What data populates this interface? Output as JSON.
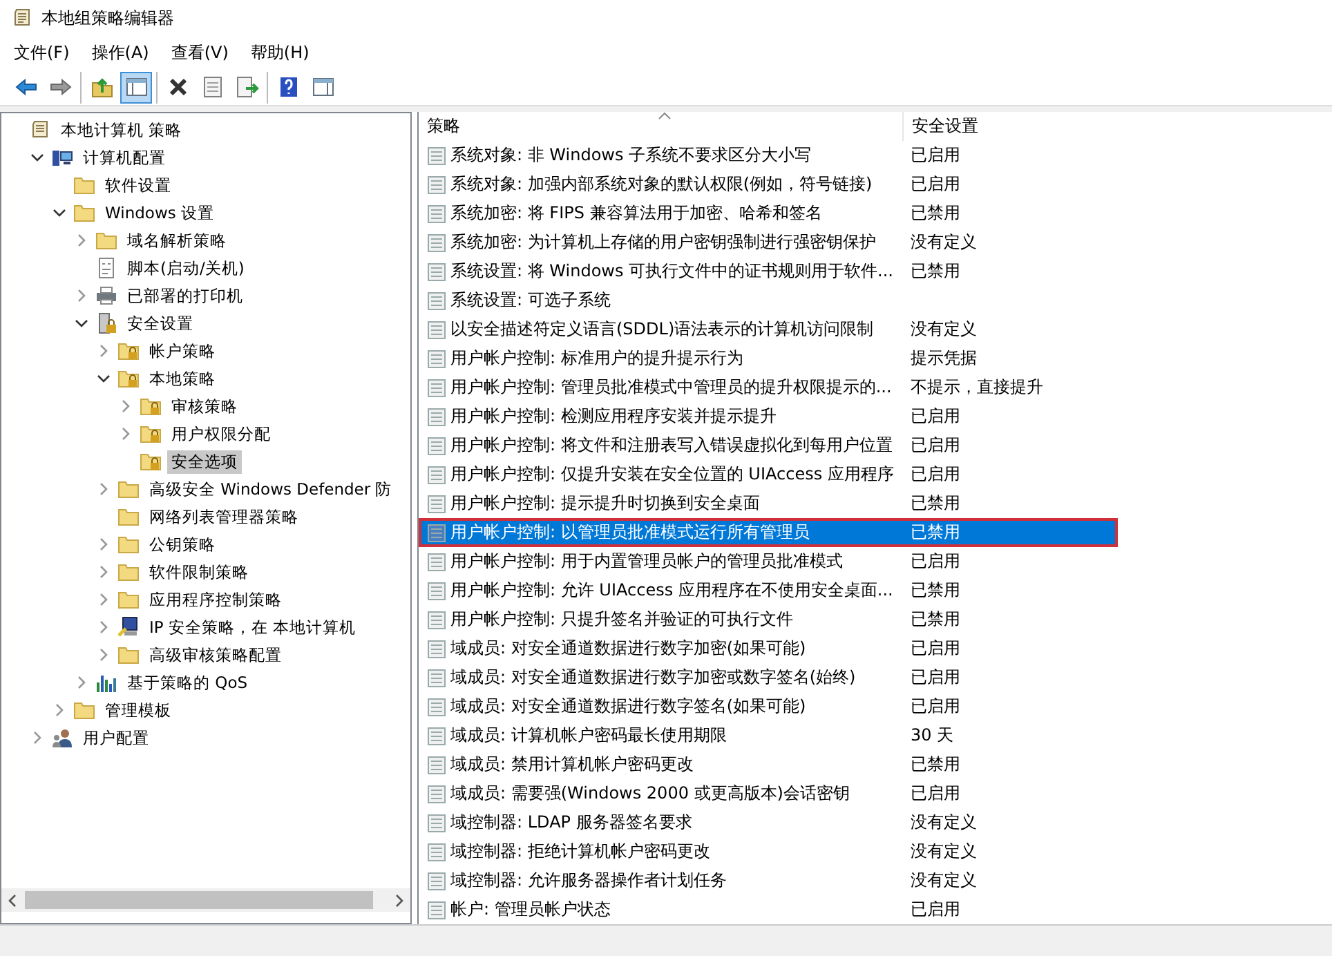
{
  "window": {
    "title": "本地组策略编辑器"
  },
  "menu": [
    "文件(F)",
    "操作(A)",
    "查看(V)",
    "帮助(H)"
  ],
  "toolbar": [
    [
      {
        "kind": "back",
        "pressed": false
      },
      {
        "kind": "forward",
        "pressed": false
      }
    ],
    [
      {
        "kind": "up",
        "pressed": false
      },
      {
        "kind": "tree",
        "pressed": true
      }
    ],
    [
      {
        "kind": "delete",
        "pressed": false
      },
      {
        "kind": "properties",
        "pressed": false
      },
      {
        "kind": "export",
        "pressed": false
      }
    ],
    [
      {
        "kind": "help",
        "pressed": false
      },
      {
        "kind": "pane",
        "pressed": false
      }
    ]
  ],
  "tree": [
    {
      "label": "本地计算机 策略",
      "kind": "doc",
      "selected": false,
      "children": [
        {
          "label": "计算机配置",
          "kind": "computer",
          "expanded": true,
          "selected": false,
          "children": [
            {
              "label": "软件设置",
              "kind": "folder",
              "selected": false
            },
            {
              "label": "Windows 设置",
              "kind": "folder",
              "expanded": true,
              "selected": false,
              "children": [
                {
                  "label": "域名解析策略",
                  "kind": "folder",
                  "expanded": false,
                  "selected": false
                },
                {
                  "label": "脚本(启动/关机)",
                  "kind": "script",
                  "selected": false
                },
                {
                  "label": "已部署的打印机",
                  "kind": "printer",
                  "expanded": false,
                  "selected": false
                },
                {
                  "label": "安全设置",
                  "kind": "secure",
                  "expanded": true,
                  "selected": false,
                  "children": [
                    {
                      "label": "帐户策略",
                      "kind": "lockfolder",
                      "expanded": false,
                      "selected": false
                    },
                    {
                      "label": "本地策略",
                      "kind": "lockfolder",
                      "expanded": true,
                      "selected": false,
                      "children": [
                        {
                          "label": "审核策略",
                          "kind": "lockfolder",
                          "expanded": false,
                          "selected": false
                        },
                        {
                          "label": "用户权限分配",
                          "kind": "lockfolder",
                          "expanded": false,
                          "selected": false
                        },
                        {
                          "label": "安全选项",
                          "kind": "lockfolder",
                          "selected": true
                        }
                      ]
                    },
                    {
                      "label": "高级安全 Windows Defender 防",
                      "kind": "folder",
                      "expanded": false,
                      "selected": false
                    },
                    {
                      "label": "网络列表管理器策略",
                      "kind": "folder",
                      "selected": false
                    },
                    {
                      "label": "公钥策略",
                      "kind": "folder",
                      "expanded": false,
                      "selected": false
                    },
                    {
                      "label": "软件限制策略",
                      "kind": "folder",
                      "expanded": false,
                      "selected": false
                    },
                    {
                      "label": "应用程序控制策略",
                      "kind": "folder",
                      "expanded": false,
                      "selected": false
                    },
                    {
                      "label": "IP 安全策略，在 本地计算机",
                      "kind": "ip",
                      "expanded": false,
                      "selected": false
                    },
                    {
                      "label": "高级审核策略配置",
                      "kind": "folder",
                      "expanded": false,
                      "selected": false
                    }
                  ]
                },
                {
                  "label": "基于策略的 QoS",
                  "kind": "qos",
                  "expanded": false,
                  "selected": false
                }
              ]
            },
            {
              "label": "管理模板",
              "kind": "folder",
              "expanded": false,
              "selected": false
            }
          ]
        },
        {
          "label": "用户配置",
          "kind": "user",
          "expanded": false,
          "selected": false
        }
      ]
    }
  ],
  "table": {
    "columns": [
      "策略",
      "安全设置"
    ],
    "rows": [
      {
        "policy": "系统对象: 非 Windows 子系统不要求区分大小写",
        "setting": "已启用",
        "selected": false
      },
      {
        "policy": "系统对象: 加强内部系统对象的默认权限(例如，符号链接)",
        "setting": "已启用",
        "selected": false
      },
      {
        "policy": "系统加密: 将 FIPS 兼容算法用于加密、哈希和签名",
        "setting": "已禁用",
        "selected": false
      },
      {
        "policy": "系统加密: 为计算机上存储的用户密钥强制进行强密钥保护",
        "setting": "没有定义",
        "selected": false
      },
      {
        "policy": "系统设置: 将 Windows 可执行文件中的证书规则用于软件...",
        "setting": "已禁用",
        "selected": false
      },
      {
        "policy": "系统设置: 可选子系统",
        "selected": false
      },
      {
        "policy": "以安全描述符定义语言(SDDL)语法表示的计算机访问限制",
        "setting": "没有定义",
        "selected": false
      },
      {
        "policy": "用户帐户控制: 标准用户的提升提示行为",
        "setting": "提示凭据",
        "selected": false
      },
      {
        "policy": "用户帐户控制: 管理员批准模式中管理员的提升权限提示的...",
        "setting": "不提示，直接提升",
        "selected": false
      },
      {
        "policy": "用户帐户控制: 检测应用程序安装并提示提升",
        "setting": "已启用",
        "selected": false
      },
      {
        "policy": "用户帐户控制: 将文件和注册表写入错误虚拟化到每用户位置",
        "setting": "已启用",
        "selected": false
      },
      {
        "policy": "用户帐户控制: 仅提升安装在安全位置的 UIAccess 应用程序",
        "setting": "已启用",
        "selected": false
      },
      {
        "policy": "用户帐户控制: 提示提升时切换到安全桌面",
        "setting": "已禁用",
        "selected": false
      },
      {
        "policy": "用户帐户控制: 以管理员批准模式运行所有管理员",
        "setting": "已禁用",
        "selected": true
      },
      {
        "policy": "用户帐户控制: 用于内置管理员帐户的管理员批准模式",
        "setting": "已启用",
        "selected": false
      },
      {
        "policy": "用户帐户控制: 允许 UIAccess 应用程序在不使用安全桌面...",
        "setting": "已禁用",
        "selected": false
      },
      {
        "policy": "用户帐户控制: 只提升签名并验证的可执行文件",
        "setting": "已禁用",
        "selected": false
      },
      {
        "policy": "域成员: 对安全通道数据进行数字加密(如果可能)",
        "setting": "已启用",
        "selected": false
      },
      {
        "policy": "域成员: 对安全通道数据进行数字加密或数字签名(始终)",
        "setting": "已启用",
        "selected": false
      },
      {
        "policy": "域成员: 对安全通道数据进行数字签名(如果可能)",
        "setting": "已启用",
        "selected": false
      },
      {
        "policy": "域成员: 计算机帐户密码最长使用期限",
        "setting": "30 天",
        "selected": false
      },
      {
        "policy": "域成员: 禁用计算机帐户密码更改",
        "setting": "已禁用",
        "selected": false
      },
      {
        "policy": "域成员: 需要强(Windows 2000 或更高版本)会话密钥",
        "setting": "已启用",
        "selected": false
      },
      {
        "policy": "域控制器: LDAP 服务器签名要求",
        "setting": "没有定义",
        "selected": false
      },
      {
        "policy": "域控制器: 拒绝计算机帐户密码更改",
        "setting": "没有定义",
        "selected": false
      },
      {
        "policy": "域控制器: 允许服务器操作者计划任务",
        "setting": "没有定义",
        "selected": false
      },
      {
        "policy": "帐户: 管理员帐户状态",
        "setting": "已启用",
        "selected": false
      }
    ]
  }
}
